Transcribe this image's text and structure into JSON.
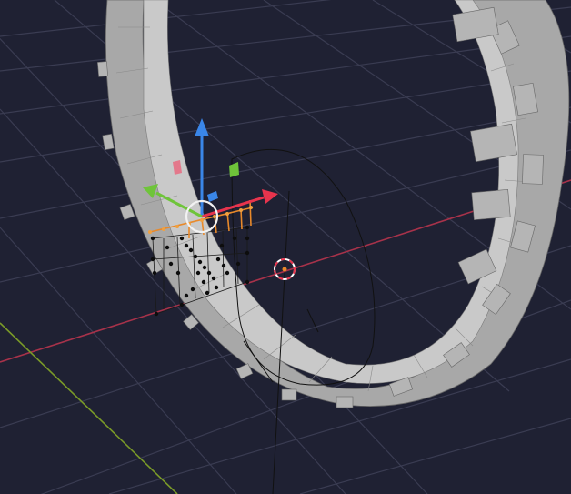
{
  "app": {
    "name": "3D Viewport",
    "view": "perspective",
    "shading": "solid"
  },
  "scene": {
    "mesh": "tire",
    "edit_mode": "edit",
    "selected_vertices_highlight": "#000000"
  },
  "colors": {
    "background": "#1f2133",
    "grid": "#3b3d54",
    "x_axis": "#b0324a",
    "y_axis": "#7f9a2c",
    "gizmo_x": "#e8344d",
    "gizmo_y": "#6fc43a",
    "gizmo_z": "#3a86e8",
    "selection": "#e8892a",
    "cursor": "#e8344d"
  },
  "gizmo": {
    "type": "translate",
    "axes": [
      "x",
      "y",
      "z"
    ]
  },
  "icons": [
    "move-gizmo-icon",
    "3d-cursor-icon",
    "pivot-circle-icon"
  ]
}
